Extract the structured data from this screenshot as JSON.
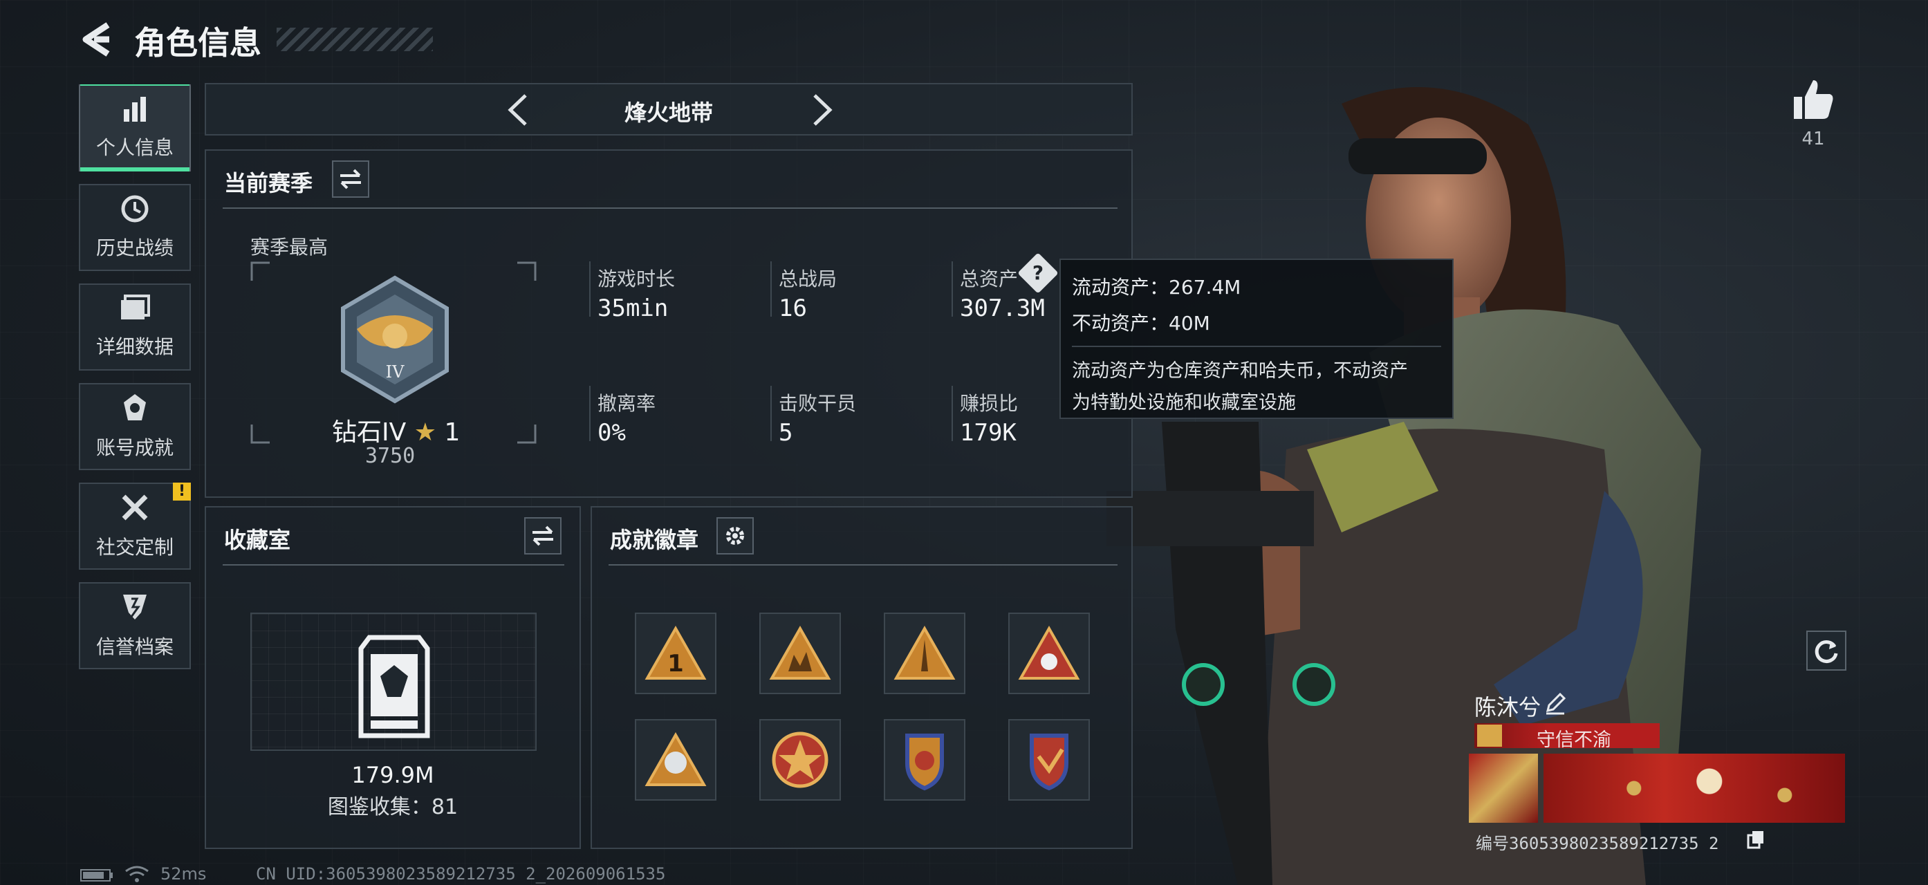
{
  "header": {
    "title": "角色信息"
  },
  "sidebar": {
    "items": [
      {
        "label": "个人信息",
        "icon": "bar-chart-icon",
        "active": true
      },
      {
        "label": "历史战绩",
        "icon": "clock-icon"
      },
      {
        "label": "详细数据",
        "icon": "folder-icon"
      },
      {
        "label": "账号成就",
        "icon": "medal-icon"
      },
      {
        "label": "社交定制",
        "icon": "tools-icon",
        "alert": "!"
      },
      {
        "label": "信誉档案",
        "icon": "shield-icon"
      }
    ]
  },
  "mode_selector": {
    "label": "烽火地带"
  },
  "season": {
    "title": "当前赛季",
    "best_label": "赛季最高",
    "rank_name": "钻石IV",
    "rank_stars": "1",
    "rank_score": "3750",
    "rank_numeral": "IV",
    "stats": [
      {
        "label": "游戏时长",
        "value": "35min"
      },
      {
        "label": "总战局",
        "value": "16"
      },
      {
        "label": "总资产",
        "value": "307.3M"
      },
      {
        "label": "撤离率",
        "value": "0%"
      },
      {
        "label": "击败干员",
        "value": "5"
      },
      {
        "label": "赚损比",
        "value": "179K"
      }
    ]
  },
  "tooltip": {
    "liquid": "流动资产：267.4M",
    "fixed": "不动资产：40M",
    "desc_line1": "流动资产为仓库资产和哈夫币，不动资产",
    "desc_line2": "为特勤处设施和收藏室设施"
  },
  "collection": {
    "title": "收藏室",
    "value": "179.9M",
    "progress": "图鉴收集：81"
  },
  "achievements": {
    "title": "成就徽章",
    "badges": [
      "badge-1",
      "badge-2",
      "badge-3",
      "badge-4",
      "badge-5",
      "badge-6",
      "badge-7",
      "badge-8"
    ]
  },
  "profile": {
    "likes": "41",
    "name": "陈沐兮",
    "reputation": "守信不渝",
    "id_label": "编号",
    "id_value": "3605398023589212735 2"
  },
  "footer": {
    "ping": "52ms",
    "uid": "CN UID:3605398023589212735 2_202609061535"
  },
  "colors": {
    "accent": "#4fe0a0",
    "gold": "#d8a84a",
    "alert": "#f0c020",
    "reputation_red": "#b41e1e"
  }
}
